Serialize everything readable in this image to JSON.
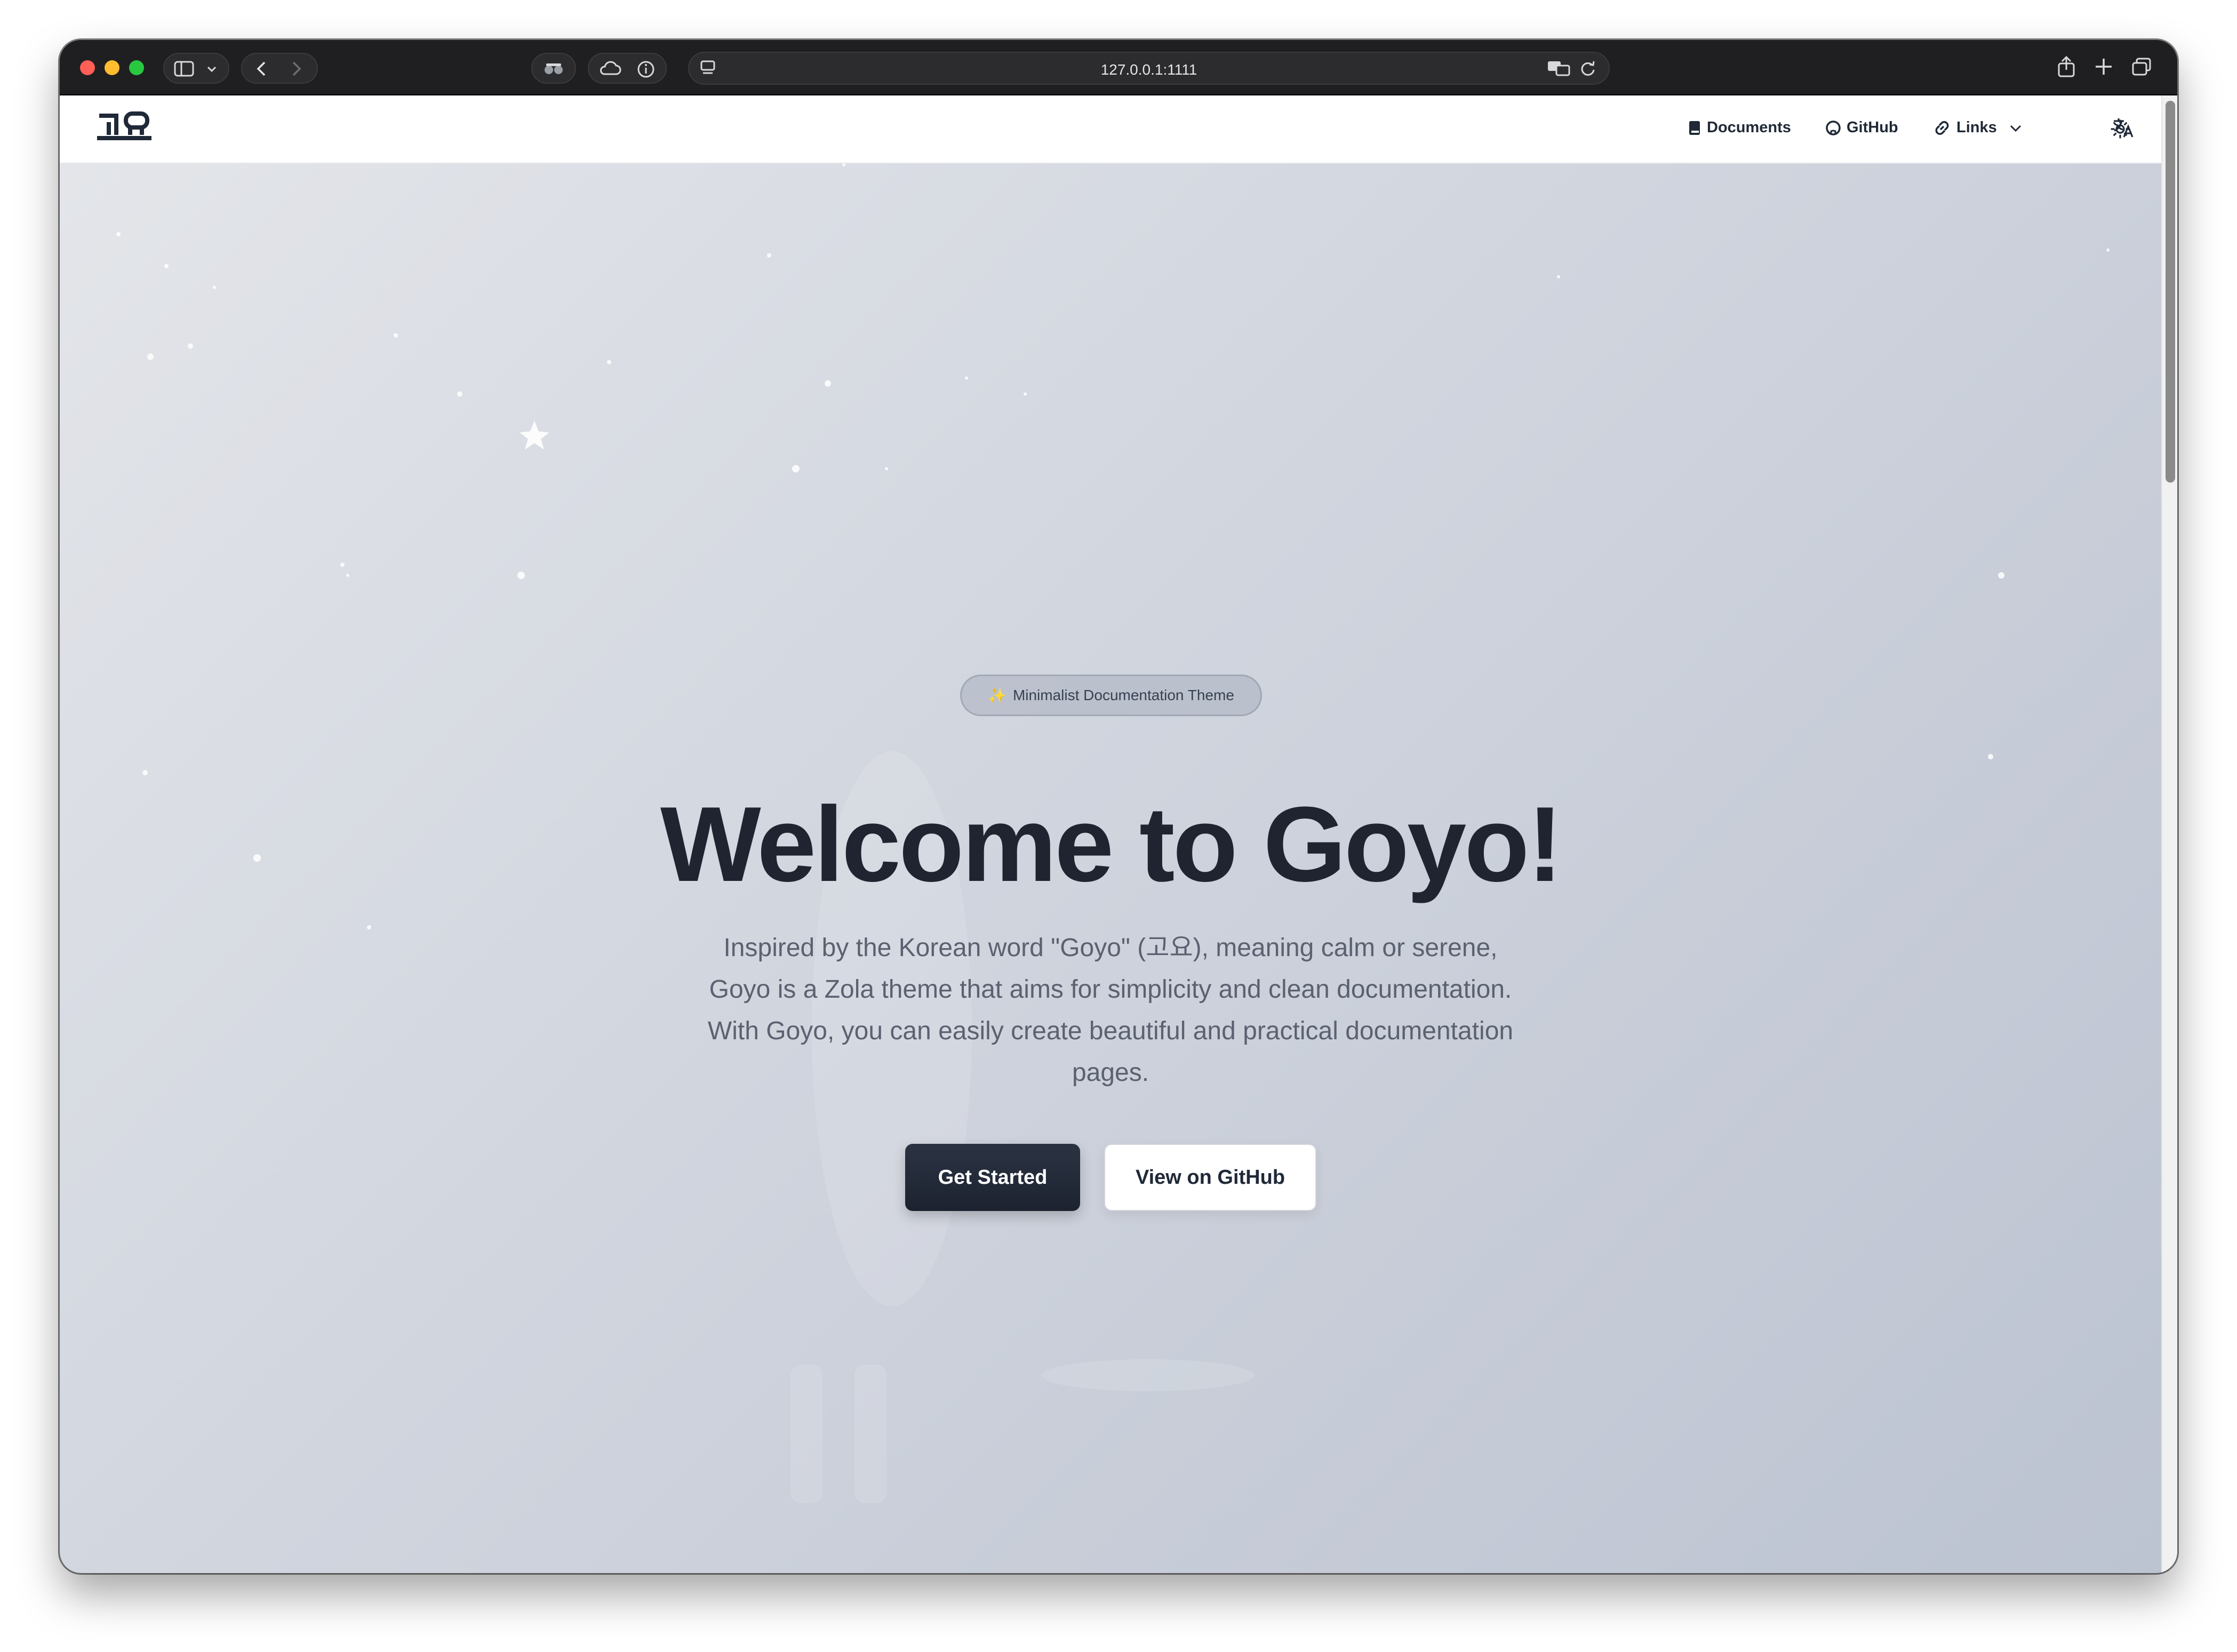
{
  "browser": {
    "address": "127.0.0.1:1111"
  },
  "site": {
    "logo_text": "고요",
    "nav": {
      "documents": "Documents",
      "github": "GitHub",
      "links": "Links"
    }
  },
  "hero": {
    "badge": "Minimalist Documentation Theme",
    "badge_icon": "✨",
    "title": "Welcome to Goyo!",
    "subtitle_lines": [
      "Inspired by the Korean word \"Goyo\" (고요), meaning calm or serene,",
      "Goyo is a Zola theme that aims for simplicity and clean documentation.",
      "With Goyo, you can easily create beautiful and practical documentation",
      "pages."
    ],
    "primary_button": "Get Started",
    "secondary_button": "View on GitHub"
  },
  "colors": {
    "accent_dark": "#1f2430",
    "background_light": "#e4e6ea",
    "background_dark": "#bcc3d1",
    "badge_spark": "#f3c623"
  },
  "icons": {
    "sidebar": "sidebar-icon",
    "back": "chevron-left-icon",
    "forward": "chevron-right-icon",
    "privacy": "privacy-report-icon",
    "icloud": "cloud-icon",
    "info": "info-icon",
    "reader": "reader-icon",
    "translate": "translate-icon",
    "reload": "reload-icon",
    "share": "share-icon",
    "new_tab": "plus-icon",
    "tabs": "tabs-overview-icon",
    "theme_toggle": "sun-icon"
  }
}
